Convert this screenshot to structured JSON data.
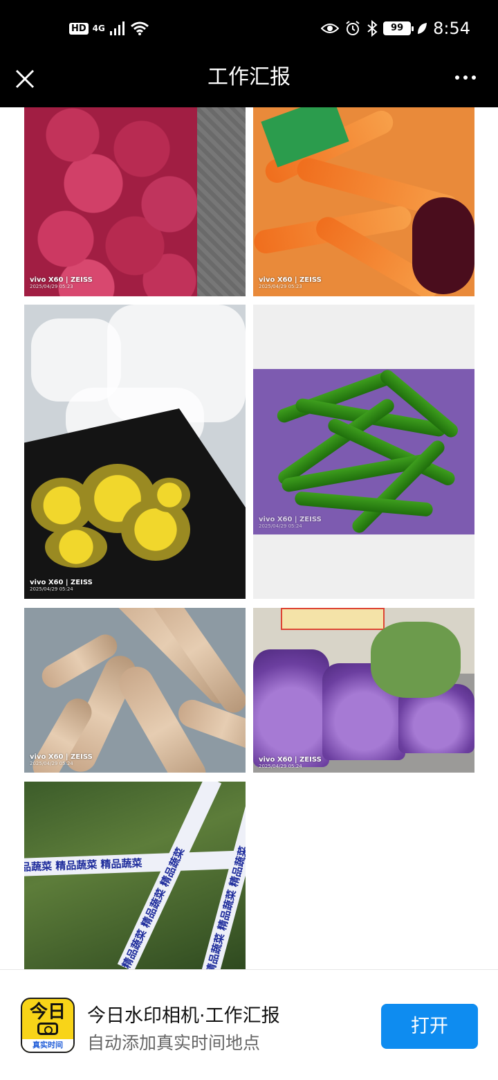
{
  "status_bar": {
    "hd_label": "HD",
    "network_label": "4G",
    "battery": "99",
    "time": "8:54",
    "icons": [
      "signal-icon",
      "wifi-icon",
      "eye-icon",
      "alarm-icon",
      "bluetooth-icon",
      "battery-icon",
      "leaf-icon"
    ]
  },
  "nav": {
    "title": "工作汇报",
    "close_icon": "close-icon",
    "more_icon": "more-icon"
  },
  "photos": [
    {
      "subject": "onions",
      "watermark_brand": "vivo X60 | ZEISS",
      "watermark_date": "2025/04/29 05:23"
    },
    {
      "subject": "carrots",
      "watermark_brand": "vivo X60 | ZEISS",
      "watermark_date": "2025/04/29 05:23"
    },
    {
      "subject": "pickled vegetables",
      "watermark_brand": "vivo X60 | ZEISS",
      "watermark_date": "2025/04/29 05:24"
    },
    {
      "subject": "green peppers",
      "watermark_brand": "vivo X60 | ZEISS",
      "watermark_date": "2025/04/29 05:24"
    },
    {
      "subject": "yams",
      "watermark_brand": "vivo X60 | ZEISS",
      "watermark_date": "2025/04/29 05:24"
    },
    {
      "subject": "purple bags",
      "watermark_brand": "vivo X60 | ZEISS",
      "watermark_date": "2025/04/29 05:24"
    },
    {
      "subject": "bundled greens",
      "tape_text": "精品蔬菜 精品蔬菜 精品蔬菜"
    }
  ],
  "banner": {
    "app_icon_big": "今日",
    "app_icon_tag": "真实时间",
    "app_name": "今日水印相机·工作汇报",
    "app_desc": "自动添加真实时间地点",
    "open_label": "打开"
  }
}
